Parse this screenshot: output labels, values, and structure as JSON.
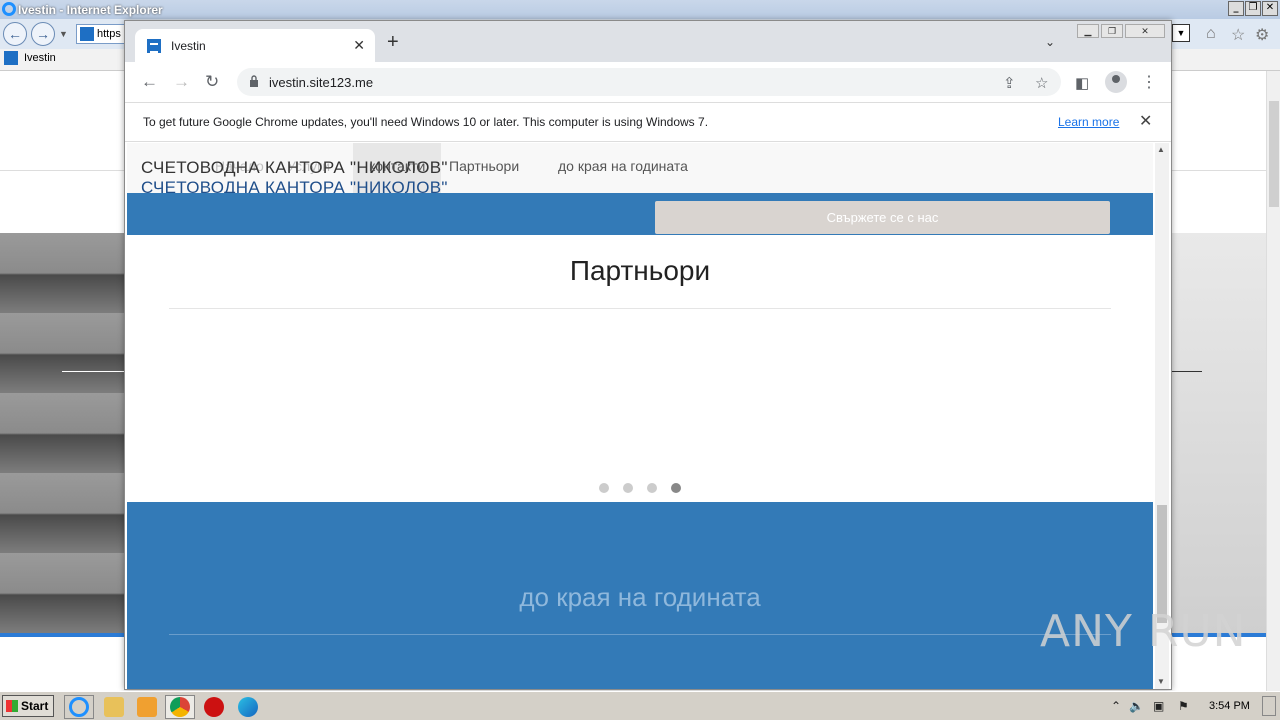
{
  "ie": {
    "title": "Ivestin - Internet Explorer",
    "address": "https",
    "tab_title": "Ivestin",
    "window_buttons": [
      "_",
      "❐",
      "✕"
    ]
  },
  "chrome": {
    "tab_title": "Ivestin",
    "tab_close": "✕",
    "new_tab": "+",
    "tab_search": "⌄",
    "url": "ivestin.site123.me",
    "info_message": "To get future Google Chrome updates, you'll need Windows 10 or later. This computer is using Windows 7.",
    "learn_more": "Learn more",
    "info_close": "✕"
  },
  "page": {
    "logo_text": "СЧЕТОВОДНА КАНТОРА \"НИКОЛОВ\"",
    "logo_text_2": "СЧЕТОВОДНА КАНТОРА \"НИКОЛОВ\"",
    "nav": {
      "home": "Начало",
      "services": "Услуги",
      "contacts": "контакти",
      "partners": "Партньори",
      "year_end": "до края на годината"
    },
    "cta": "Свържете се с нас",
    "partners_heading": "Партньори",
    "carousel_dots": 4,
    "carousel_active": 4,
    "year_heading": "до края на годината"
  },
  "watermark": "ANY RUN",
  "taskbar": {
    "start": "Start",
    "clock": "3:54 PM"
  }
}
